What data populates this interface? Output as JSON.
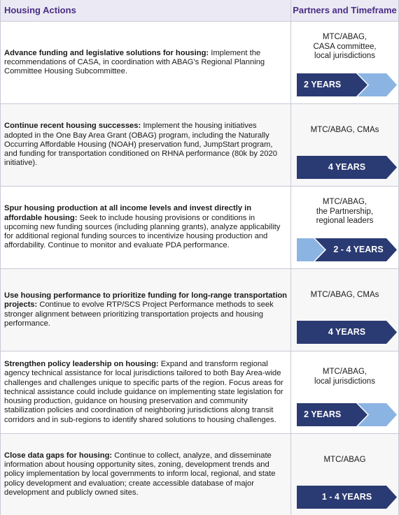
{
  "header": {
    "left": "Housing Actions",
    "right": "Partners and Timeframe"
  },
  "colors": {
    "dark": "#2a3a72",
    "light": "#8cb4e2",
    "header_text": "#4a2d86",
    "header_bg": "#ebe9f3"
  },
  "rows": [
    {
      "title": "Advance funding and legislative solutions for housing:",
      "body": " Implement the recommendations of CASA, in coordination with ABAG's Regional Planning Committee Housing Subcommittee.",
      "partners": [
        "MTC/ABAG,",
        "CASA committee,",
        "local jurisdictions"
      ],
      "timeframe": "2 YEARS"
    },
    {
      "title": "Continue recent housing successes:",
      "body": " Implement the housing initiatives adopted in the One Bay Area Grant (OBAG) program, including the Naturally Occurring Affordable Housing (NOAH) preservation fund, JumpStart program, and funding for transportation conditioned on RHNA performance (80k by 2020 initiative).",
      "partners": [
        "MTC/ABAG, CMAs"
      ],
      "timeframe": "4 YEARS"
    },
    {
      "title": "Spur housing production at all income levels and invest directly in affordable housing:",
      "body": " Seek to include housing provisions or conditions in upcoming new funding sources (including planning grants), analyze applicability for additional regional funding sources to incentivize housing production and affordability. Continue to monitor and evaluate PDA performance.",
      "partners": [
        "MTC/ABAG,",
        "the Partnership,",
        "regional leaders"
      ],
      "timeframe": "2 - 4 YEARS"
    },
    {
      "title": "Use housing performance to prioritize funding for long-range transportation projects:",
      "body": " Continue to evolve RTP/SCS Project Performance methods to seek stronger alignment between prioritizing transportation projects and housing performance.",
      "partners": [
        "MTC/ABAG, CMAs"
      ],
      "timeframe": "4 YEARS"
    },
    {
      "title": "Strengthen policy leadership on housing:",
      "body": " Expand and transform regional agency technical assistance for local jurisdictions tailored to both Bay Area-wide challenges and challenges unique to specific parts of the region. Focus areas for technical assistance could include guidance on implementing state legislation for housing production, guidance on housing preservation and community stabilization policies and coordination of neighboring jurisdictions along transit corridors and in sub-regions to identify shared solutions to housing challenges.",
      "partners": [
        "MTC/ABAG,",
        "local jurisdictions"
      ],
      "timeframe": "2 YEARS"
    },
    {
      "title": "Close data gaps for housing:",
      "body": " Continue to collect, analyze, and disseminate information about housing opportunity sites, zoning, development trends and policy implementation by local governments to inform local, regional, and state policy development and evaluation; create accessible database of major development and publicly owned sites.",
      "partners": [
        "MTC/ABAG"
      ],
      "timeframe": "1 - 4 YEARS"
    }
  ]
}
